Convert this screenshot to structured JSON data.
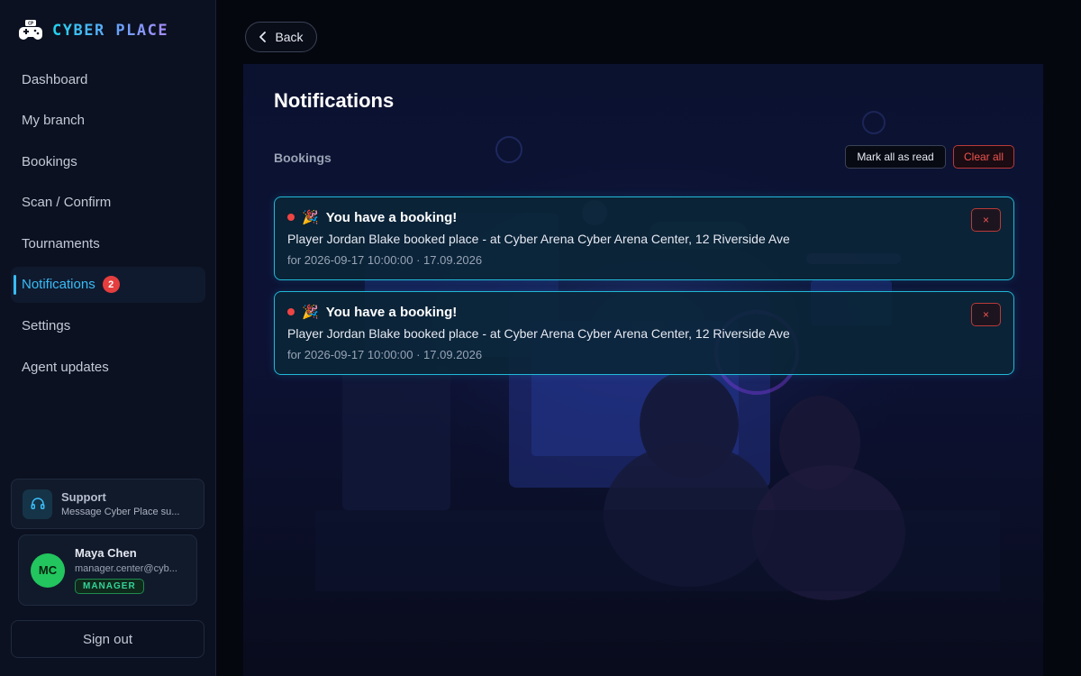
{
  "brand": {
    "name": "CYBER PLACE",
    "logo_icon": "gamepad-icon"
  },
  "sidebar": {
    "items": [
      {
        "label": "Dashboard"
      },
      {
        "label": "My branch"
      },
      {
        "label": "Bookings"
      },
      {
        "label": "Scan / Confirm"
      },
      {
        "label": "Tournaments"
      },
      {
        "label": "Notifications",
        "badge": "2",
        "active": true
      },
      {
        "label": "Settings"
      },
      {
        "label": "Agent updates"
      }
    ],
    "support": {
      "title": "Support",
      "subtitle": "Message Cyber Place su...",
      "icon": "headset-icon"
    },
    "user": {
      "initials": "MC",
      "name": "Maya Chen",
      "email": "manager.center@cyb...",
      "role": "MANAGER"
    },
    "signout_label": "Sign out"
  },
  "main": {
    "back_label": "Back",
    "title": "Notifications",
    "section": "Bookings",
    "mark_all_label": "Mark all as read",
    "clear_all_label": "Clear all",
    "notifications": [
      {
        "emoji": "🎉",
        "title": "You have a booking!",
        "body": "Player Jordan Blake booked place - at Cyber Arena Cyber Arena Center, 12 Riverside Ave",
        "meta": "for 2026-09-17 10:00:00 · 17.09.2026",
        "close": "×"
      },
      {
        "emoji": "🎉",
        "title": "You have a booking!",
        "body": "Player Jordan Blake booked place - at Cyber Arena Cyber Arena Center, 12 Riverside Ave",
        "meta": "for 2026-09-17 10:00:00 · 17.09.2026",
        "close": "×"
      }
    ]
  },
  "colors": {
    "accent": "#38bdf8",
    "card_border": "#22b8d8",
    "danger": "#ef4444",
    "success": "#22c55e"
  }
}
